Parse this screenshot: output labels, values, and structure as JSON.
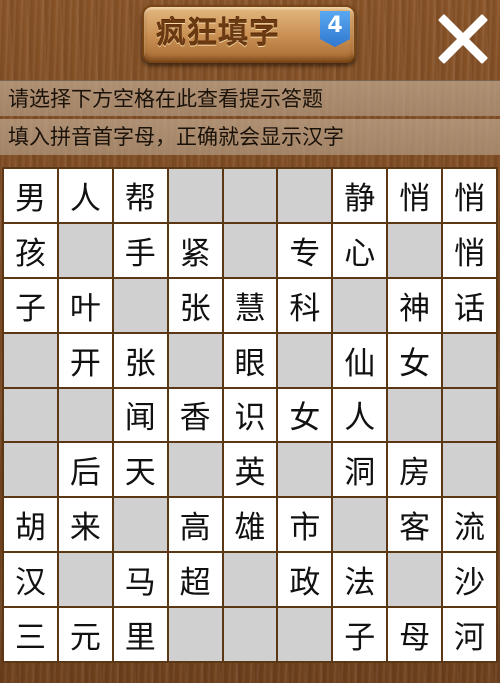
{
  "header": {
    "title": "疯狂填字",
    "level": "4",
    "close_icon": "close-icon",
    "colors": {
      "plaque": "#c98f52",
      "badge": "#2f78cf"
    }
  },
  "hints": [
    "请选择下方空格在此查看提示答题",
    "填入拼音首字母，正确就会显示汉字"
  ],
  "grid": {
    "rows": [
      [
        "男",
        "人",
        "帮",
        null,
        null,
        null,
        "静",
        "悄",
        "悄"
      ],
      [
        "孩",
        null,
        "手",
        "紧",
        null,
        "专",
        "心",
        null,
        "悄"
      ],
      [
        "子",
        "叶",
        null,
        "张",
        "慧",
        "科",
        null,
        "神",
        "话"
      ],
      [
        null,
        "开",
        "张",
        null,
        "眼",
        null,
        "仙",
        "女",
        null
      ],
      [
        null,
        null,
        "闻",
        "香",
        "识",
        "女",
        "人",
        null,
        null
      ],
      [
        null,
        "后",
        "天",
        null,
        "英",
        null,
        "洞",
        "房",
        null
      ],
      [
        "胡",
        "来",
        null,
        "高",
        "雄",
        "市",
        null,
        "客",
        "流"
      ],
      [
        "汉",
        null,
        "马",
        "超",
        null,
        "政",
        "法",
        null,
        "沙"
      ],
      [
        "三",
        "元",
        "里",
        null,
        null,
        null,
        "子",
        "母",
        "河"
      ]
    ]
  }
}
